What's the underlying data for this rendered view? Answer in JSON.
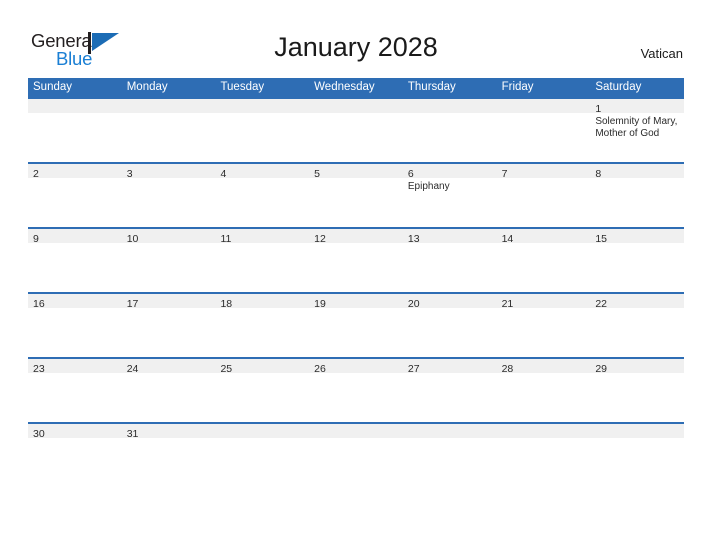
{
  "brand": {
    "name_top": "General",
    "name_bottom": "Blue",
    "accent_color": "#1a7fd4",
    "flag_icon": "triangle-flag-icon"
  },
  "header": {
    "title": "January 2028",
    "region": "Vatican"
  },
  "colors": {
    "header_blue": "#2e6db4",
    "daynum_band_gray": "#f0f0f0",
    "text_dark": "#1a1a1a",
    "brand_blue": "#1a7fd4"
  },
  "calendar": {
    "month": "January",
    "year": "2028",
    "weekday_headers": [
      "Sunday",
      "Monday",
      "Tuesday",
      "Wednesday",
      "Thursday",
      "Friday",
      "Saturday"
    ],
    "weeks": [
      [
        {
          "day": "",
          "event": ""
        },
        {
          "day": "",
          "event": ""
        },
        {
          "day": "",
          "event": ""
        },
        {
          "day": "",
          "event": ""
        },
        {
          "day": "",
          "event": ""
        },
        {
          "day": "",
          "event": ""
        },
        {
          "day": "1",
          "event": "Solemnity of Mary, Mother of God"
        }
      ],
      [
        {
          "day": "2",
          "event": ""
        },
        {
          "day": "3",
          "event": ""
        },
        {
          "day": "4",
          "event": ""
        },
        {
          "day": "5",
          "event": ""
        },
        {
          "day": "6",
          "event": "Epiphany"
        },
        {
          "day": "7",
          "event": ""
        },
        {
          "day": "8",
          "event": ""
        }
      ],
      [
        {
          "day": "9",
          "event": ""
        },
        {
          "day": "10",
          "event": ""
        },
        {
          "day": "11",
          "event": ""
        },
        {
          "day": "12",
          "event": ""
        },
        {
          "day": "13",
          "event": ""
        },
        {
          "day": "14",
          "event": ""
        },
        {
          "day": "15",
          "event": ""
        }
      ],
      [
        {
          "day": "16",
          "event": ""
        },
        {
          "day": "17",
          "event": ""
        },
        {
          "day": "18",
          "event": ""
        },
        {
          "day": "19",
          "event": ""
        },
        {
          "day": "20",
          "event": ""
        },
        {
          "day": "21",
          "event": ""
        },
        {
          "day": "22",
          "event": ""
        }
      ],
      [
        {
          "day": "23",
          "event": ""
        },
        {
          "day": "24",
          "event": ""
        },
        {
          "day": "25",
          "event": ""
        },
        {
          "day": "26",
          "event": ""
        },
        {
          "day": "27",
          "event": ""
        },
        {
          "day": "28",
          "event": ""
        },
        {
          "day": "29",
          "event": ""
        }
      ],
      [
        {
          "day": "30",
          "event": ""
        },
        {
          "day": "31",
          "event": ""
        },
        {
          "day": "",
          "event": ""
        },
        {
          "day": "",
          "event": ""
        },
        {
          "day": "",
          "event": ""
        },
        {
          "day": "",
          "event": ""
        },
        {
          "day": "",
          "event": ""
        }
      ]
    ]
  }
}
